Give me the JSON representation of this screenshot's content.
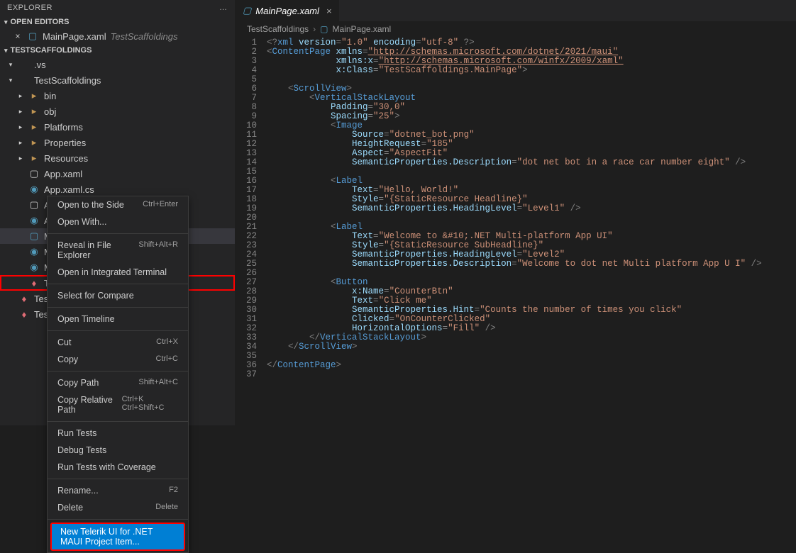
{
  "explorer": {
    "title": "EXPLORER",
    "open_editors": {
      "label": "OPEN EDITORS",
      "items": [
        {
          "name": "MainPage.xaml",
          "detail": "TestScaffoldings"
        }
      ]
    },
    "project_name": "TESTSCAFFOLDINGS",
    "tree": [
      {
        "depth": 0,
        "twisty": "▾",
        "icon": "",
        "label": ".vs"
      },
      {
        "depth": 0,
        "twisty": "▾",
        "icon": "",
        "label": "TestScaffoldings"
      },
      {
        "depth": 1,
        "twisty": "▸",
        "icon": "folder",
        "label": "bin"
      },
      {
        "depth": 1,
        "twisty": "▸",
        "icon": "folder",
        "label": "obj"
      },
      {
        "depth": 1,
        "twisty": "▸",
        "icon": "folder",
        "label": "Platforms"
      },
      {
        "depth": 1,
        "twisty": "▸",
        "icon": "folder",
        "label": "Properties"
      },
      {
        "depth": 1,
        "twisty": "▸",
        "icon": "folder",
        "label": "Resources"
      },
      {
        "depth": 1,
        "twisty": "",
        "icon": "blank",
        "label": "App.xaml"
      },
      {
        "depth": 1,
        "twisty": "",
        "icon": "cs",
        "label": "App.xaml.cs"
      },
      {
        "depth": 1,
        "twisty": "",
        "icon": "blank",
        "label": "AppShell.xaml"
      },
      {
        "depth": 1,
        "twisty": "",
        "icon": "cs",
        "label": "AppShell.xaml.cs"
      },
      {
        "depth": 1,
        "twisty": "",
        "icon": "xaml",
        "label": "MainPage.xaml",
        "selected": true
      },
      {
        "depth": 1,
        "twisty": "",
        "icon": "cs",
        "label": "MainPage.xaml.cs"
      },
      {
        "depth": 1,
        "twisty": "",
        "icon": "cs",
        "label": "MauiProgram.cs"
      },
      {
        "depth": 1,
        "twisty": "",
        "icon": "proj",
        "label": "TestScaffoldings.csproj",
        "highlighted": true
      },
      {
        "depth": 0,
        "twisty": "",
        "icon": "proj",
        "label": "TestScaffo…"
      },
      {
        "depth": 0,
        "twisty": "",
        "icon": "proj",
        "label": "TestScaffolding"
      }
    ]
  },
  "context_menu": {
    "items": [
      {
        "label": "Open to the Side",
        "kbd": "Ctrl+Enter"
      },
      {
        "label": "Open With..."
      },
      {
        "sep": true
      },
      {
        "label": "Reveal in File Explorer",
        "kbd": "Shift+Alt+R"
      },
      {
        "label": "Open in Integrated Terminal"
      },
      {
        "sep": true
      },
      {
        "label": "Select for Compare"
      },
      {
        "sep": true
      },
      {
        "label": "Open Timeline"
      },
      {
        "sep": true
      },
      {
        "label": "Cut",
        "kbd": "Ctrl+X"
      },
      {
        "label": "Copy",
        "kbd": "Ctrl+C"
      },
      {
        "sep": true
      },
      {
        "label": "Copy Path",
        "kbd": "Shift+Alt+C"
      },
      {
        "label": "Copy Relative Path",
        "kbd": "Ctrl+K Ctrl+Shift+C"
      },
      {
        "sep": true
      },
      {
        "label": "Run Tests"
      },
      {
        "label": "Debug Tests"
      },
      {
        "label": "Run Tests with Coverage"
      },
      {
        "sep": true
      },
      {
        "label": "Rename...",
        "kbd": "F2"
      },
      {
        "label": "Delete",
        "kbd": "Delete"
      },
      {
        "sep": true
      },
      {
        "label": "New Telerik UI for .NET MAUI Project Item...",
        "highlight": true
      }
    ]
  },
  "editor": {
    "tab": {
      "filename": "MainPage.xaml"
    },
    "breadcrumb": {
      "a": "TestScaffoldings",
      "b": "MainPage.xaml"
    },
    "code_lines": [
      "<span class='s-gray'>&lt;?</span><span class='s-blue'>xml</span> <span class='s-attr'>version</span><span class='s-gray'>=</span><span class='s-str'>\"1.0\"</span> <span class='s-attr'>encoding</span><span class='s-gray'>=</span><span class='s-str'>\"utf-8\"</span> <span class='s-gray'>?&gt;</span>",
      "<span class='s-gray'>&lt;</span><span class='s-blue'>ContentPage</span> <span class='s-attr'>xmlns</span><span class='s-gray'>=</span><span class='s-str s-under'>\"http://schemas.microsoft.com/dotnet/2021/maui\"</span>",
      "             <span class='s-attr'>xmlns:x</span><span class='s-gray'>=</span><span class='s-str s-under'>\"http://schemas.microsoft.com/winfx/2009/xaml\"</span>",
      "             <span class='s-attr'>x:Class</span><span class='s-gray'>=</span><span class='s-str'>\"TestScaffoldings.MainPage\"</span><span class='s-gray'>&gt;</span>",
      "",
      "    <span class='s-gray'>&lt;</span><span class='s-blue'>ScrollView</span><span class='s-gray'>&gt;</span>",
      "        <span class='s-gray'>&lt;</span><span class='s-blue'>VerticalStackLayout</span>",
      "            <span class='s-attr'>Padding</span><span class='s-gray'>=</span><span class='s-str'>\"30,0\"</span>",
      "            <span class='s-attr'>Spacing</span><span class='s-gray'>=</span><span class='s-str'>\"25\"</span><span class='s-gray'>&gt;</span>",
      "            <span class='s-gray'>&lt;</span><span class='s-blue'>Image</span>",
      "                <span class='s-attr'>Source</span><span class='s-gray'>=</span><span class='s-str'>\"dotnet_bot.png\"</span>",
      "                <span class='s-attr'>HeightRequest</span><span class='s-gray'>=</span><span class='s-str'>\"185\"</span>",
      "                <span class='s-attr'>Aspect</span><span class='s-gray'>=</span><span class='s-str'>\"AspectFit\"</span>",
      "                <span class='s-attr'>SemanticProperties.Description</span><span class='s-gray'>=</span><span class='s-str'>\"dot net bot in a race car number eight\"</span> <span class='s-gray'>/&gt;</span>",
      "",
      "            <span class='s-gray'>&lt;</span><span class='s-blue'>Label</span>",
      "                <span class='s-attr'>Text</span><span class='s-gray'>=</span><span class='s-str'>\"Hello, World!\"</span>",
      "                <span class='s-attr'>Style</span><span class='s-gray'>=</span><span class='s-str'>\"{StaticResource Headline}\"</span>",
      "                <span class='s-attr'>SemanticProperties.HeadingLevel</span><span class='s-gray'>=</span><span class='s-str'>\"Level1\"</span> <span class='s-gray'>/&gt;</span>",
      "",
      "            <span class='s-gray'>&lt;</span><span class='s-blue'>Label</span>",
      "                <span class='s-attr'>Text</span><span class='s-gray'>=</span><span class='s-str'>\"Welcome to &amp;#10;.NET Multi-platform App UI\"</span>",
      "                <span class='s-attr'>Style</span><span class='s-gray'>=</span><span class='s-str'>\"{StaticResource SubHeadline}\"</span>",
      "                <span class='s-attr'>SemanticProperties.HeadingLevel</span><span class='s-gray'>=</span><span class='s-str'>\"Level2\"</span>",
      "                <span class='s-attr'>SemanticProperties.Description</span><span class='s-gray'>=</span><span class='s-str'>\"Welcome to dot net Multi platform App U I\"</span> <span class='s-gray'>/&gt;</span>",
      "",
      "            <span class='s-gray'>&lt;</span><span class='s-blue'>Button</span>",
      "                <span class='s-attr'>x:Name</span><span class='s-gray'>=</span><span class='s-str'>\"CounterBtn\"</span>",
      "                <span class='s-attr'>Text</span><span class='s-gray'>=</span><span class='s-str'>\"Click me\"</span>",
      "                <span class='s-attr'>SemanticProperties.Hint</span><span class='s-gray'>=</span><span class='s-str'>\"Counts the number of times you click\"</span>",
      "                <span class='s-attr'>Clicked</span><span class='s-gray'>=</span><span class='s-str'>\"OnCounterClicked\"</span>",
      "                <span class='s-attr'>HorizontalOptions</span><span class='s-gray'>=</span><span class='s-str'>\"Fill\"</span> <span class='s-gray'>/&gt;</span>",
      "        <span class='s-gray'>&lt;/</span><span class='s-blue'>VerticalStackLayout</span><span class='s-gray'>&gt;</span>",
      "    <span class='s-gray'>&lt;/</span><span class='s-blue'>ScrollView</span><span class='s-gray'>&gt;</span>",
      "",
      "<span class='s-gray'>&lt;/</span><span class='s-blue'>ContentPage</span><span class='s-gray'>&gt;</span>",
      ""
    ]
  }
}
